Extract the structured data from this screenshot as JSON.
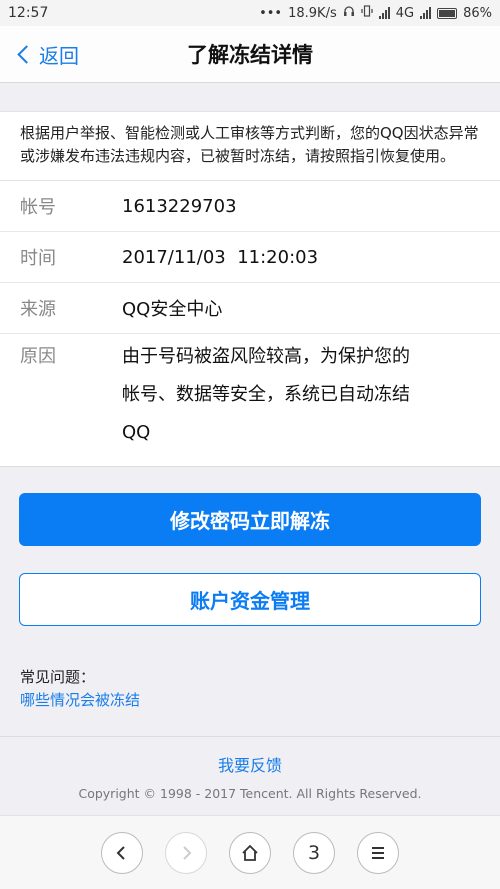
{
  "status": {
    "time": "12:57",
    "dots": "•••",
    "speed": "18.9K/s",
    "network": "4G",
    "battery": "86%"
  },
  "nav": {
    "back_label": "返回",
    "title": "了解冻结详情"
  },
  "notice": {
    "text": "根据用户举报、智能检测或人工审核等方式判断，您的QQ因状态异常或涉嫌发布违法违规内容，已被暂时冻结，请按照指引恢复使用。"
  },
  "info": {
    "account_label": "帐号",
    "account_value": "1613229703",
    "time_label": "时间",
    "time_value": "2017/11/03  11:20:03",
    "source_label": "来源",
    "source_value": "QQ安全中心",
    "reason_label": "原因",
    "reason_lines": [
      "由于号码被盗风险较高，为保护您的",
      "帐号、数据等安全，系统已自动冻结",
      "QQ"
    ]
  },
  "buttons": {
    "primary": "修改密码立即解冻",
    "secondary": "账户资金管理"
  },
  "faq": {
    "title": "常见问题：",
    "link": "哪些情况会被冻结"
  },
  "footer": {
    "feedback": "我要反馈",
    "copyright": "Copyright © 1998 - 2017 Tencent. All Rights Reserved."
  },
  "browser": {
    "tab_count": "3"
  },
  "colors": {
    "accent": "#0a7cf4"
  }
}
